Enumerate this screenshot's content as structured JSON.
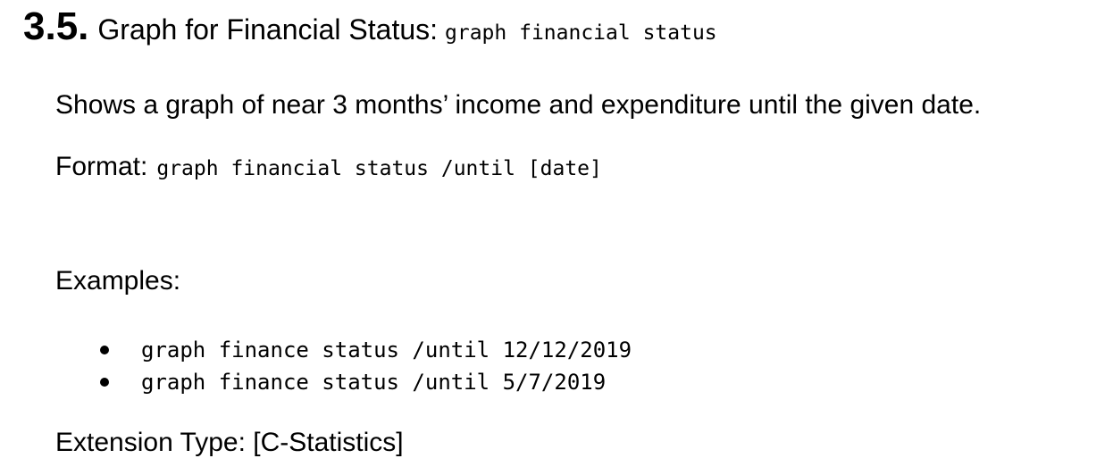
{
  "section": {
    "number": "3.5.",
    "title": "Graph for Financial Status:",
    "command": "graph financial status"
  },
  "description": "Shows a graph of near 3 months’ income and expenditure until the given date.",
  "format": {
    "label": "Format:",
    "syntax": "graph financial status /until [date]"
  },
  "examples": {
    "label": "Examples:",
    "items": [
      "graph finance status /until 12/12/2019",
      "graph finance status /until 5/7/2019"
    ]
  },
  "extension_type": "Extension Type: [C-Statistics]"
}
